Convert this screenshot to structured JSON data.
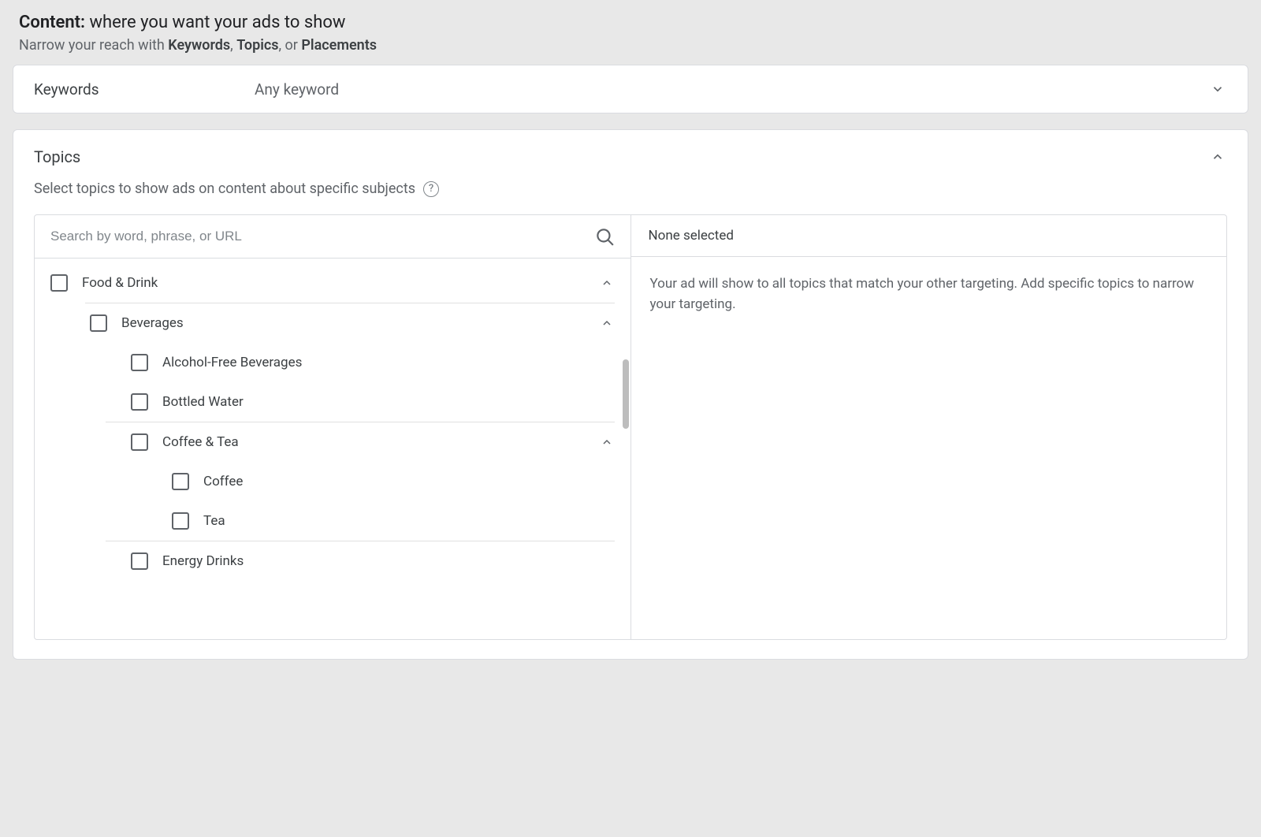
{
  "header": {
    "title_bold": "Content:",
    "title_rest": " where you want your ads to show",
    "sub_pre": "Narrow your reach with ",
    "sub_keywords": "Keywords",
    "sub_sep1": ", ",
    "sub_topics": "Topics",
    "sub_sep2": ", or ",
    "sub_placements": "Placements"
  },
  "keywords": {
    "label": "Keywords",
    "value": "Any keyword"
  },
  "topics": {
    "title": "Topics",
    "description": "Select topics to show ads on content about specific subjects",
    "search_placeholder": "Search by word, phrase, or URL",
    "tree": {
      "l0_food": "Food & Drink",
      "l1_bev": "Beverages",
      "l2_alcfree": "Alcohol-Free Beverages",
      "l2_bottled": "Bottled Water",
      "l2_coffee_tea": "Coffee & Tea",
      "l3_coffee": "Coffee",
      "l3_tea": "Tea",
      "l2_energy": "Energy Drinks"
    },
    "right": {
      "none_selected": "None selected",
      "blurb": "Your ad will show to all topics that match your other targeting. Add specific topics to narrow your targeting."
    }
  }
}
